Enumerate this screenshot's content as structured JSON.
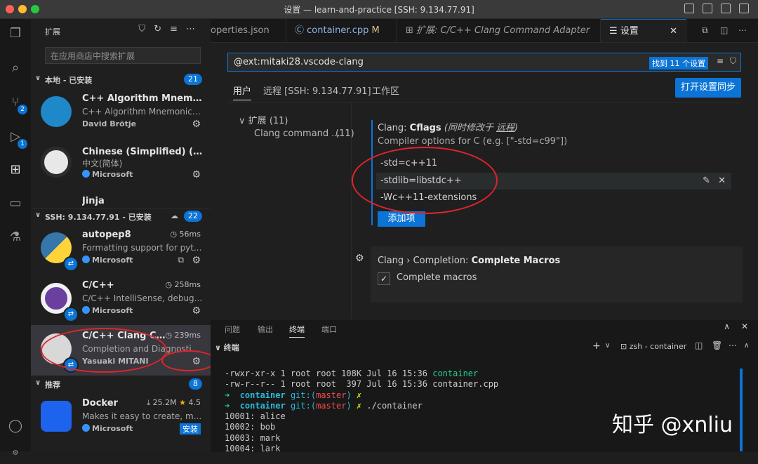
{
  "window": {
    "title": "设置 — learn-and-practice [SSH: 9.134.77.91]"
  },
  "activity": {
    "scm_badge": "2",
    "debug_badge": "1"
  },
  "sidebar": {
    "header": "扩展",
    "search_placeholder": "在应用商店中搜索扩展",
    "local_section": {
      "label": "本地 - 已安装",
      "count": "21"
    },
    "local_items": [
      {
        "name": "C++ Algorithm Mnemonics",
        "desc": "C++ Algorithm Mnemonics...",
        "publisher": "David Brötje"
      },
      {
        "name": "Chinese (Simplified) (简...",
        "desc": "中文(简体)",
        "publisher": "Microsoft"
      },
      {
        "name": "Jinja"
      }
    ],
    "ssh_section": {
      "label": "SSH: 9.134.77.91 - 已安装",
      "count": "22"
    },
    "ssh_items": [
      {
        "name": "autopep8",
        "desc": "Formatting support for pyt...",
        "publisher": "Microsoft",
        "time": "56ms"
      },
      {
        "name": "C/C++",
        "desc": "C/C++ IntelliSense, debug...",
        "publisher": "Microsoft",
        "time": "258ms"
      },
      {
        "name": "C/C++ Clang Co...",
        "desc": "Completion and Diagnosti...",
        "publisher": "Yasuaki MITANI",
        "time": "239ms"
      }
    ],
    "rec_section": {
      "label": "推荐",
      "count": "8"
    },
    "rec_items": [
      {
        "name": "Docker",
        "desc": "Makes it easy to create, m...",
        "publisher": "Microsoft",
        "downloads": "25.2M",
        "rating": "4.5",
        "install": "安装"
      }
    ]
  },
  "tabs": [
    {
      "label": "operties.json"
    },
    {
      "label": "container.cpp",
      "mark": "M"
    },
    {
      "label": "扩展: C/C++ Clang Command Adapter"
    },
    {
      "label": "设置"
    }
  ],
  "settings": {
    "query": "@ext:mitaki28.vscode-clang",
    "found": "找到 11 个设置",
    "scopes": [
      "用户",
      "远程 [SSH: 9.134.77.91]",
      "工作区"
    ],
    "sync_button": "打开设置同步",
    "tree": [
      {
        "label": "扩展",
        "count": "(11)"
      },
      {
        "label": "Clang command ...",
        "count": "(11)"
      }
    ],
    "cflags": {
      "prefix": "Clang: ",
      "name": "Cflags",
      "modified": "(同时修改于 ",
      "modified_link": "远程",
      "modified_end": ")",
      "desc": "Compiler options for C (e.g. [\"-std=c99\"])",
      "items": [
        "-std=c++11",
        "-stdlib=libstdc++",
        "-Wc++11-extensions"
      ],
      "add_button": "添加项"
    },
    "macros": {
      "prefix": "Clang › Completion: ",
      "name": "Complete Macros",
      "checkbox_label": "Complete macros"
    }
  },
  "panel": {
    "tabs": [
      "问题",
      "输出",
      "终端",
      "端口"
    ],
    "terminal_header": "终端",
    "shell_name": "zsh - container",
    "terminal_lines": [
      {
        "perm": "-rwxr-xr-x 1 root root 108K Jul 16 15:36 ",
        "file": "container"
      },
      {
        "perm": "-rw-r--r-- 1 root root  397 Jul 16 15:36 ",
        "file": "container.cpp"
      },
      {
        "dir": "container",
        "git": "git:(",
        "branch": "master",
        "git_end": ") ",
        "cmd": ""
      },
      {
        "dir": "container",
        "git": "git:(",
        "branch": "master",
        "git_end": ") ",
        "cmd": "./container"
      },
      {
        "out": "10001: alice"
      },
      {
        "out": "10002: bob"
      },
      {
        "out": "10003: mark"
      },
      {
        "out": "10004: lark"
      }
    ]
  },
  "watermark": "知乎 @xnliu"
}
